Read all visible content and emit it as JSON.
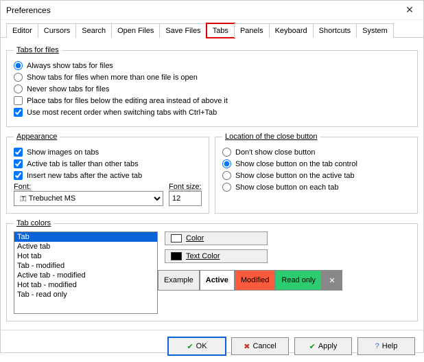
{
  "title": "Preferences",
  "tabs": [
    "Editor",
    "Cursors",
    "Search",
    "Open Files",
    "Save Files",
    "Tabs",
    "Panels",
    "Keyboard",
    "Shortcuts",
    "System"
  ],
  "activeTabIndex": 5,
  "group1": {
    "legend": "Tabs for files",
    "r1": "Always show tabs for files",
    "r2": "Show tabs for files when more than one file is open",
    "r3": "Never show tabs for files",
    "c1": "Place tabs for files below the editing area instead of above it",
    "c2": "Use most recent order when switching tabs with Ctrl+Tab"
  },
  "appearance": {
    "legend": "Appearance",
    "c1": "Show images on tabs",
    "c2": "Active tab is taller than other tabs",
    "c3": "Insert new tabs after the active tab",
    "fontLabel": "Font:",
    "fontValue": "Trebuchet MS",
    "sizeLabel": "Font size:",
    "sizeValue": "12"
  },
  "closebtn": {
    "legend": "Location of the close button",
    "r1": "Don't show close button",
    "r2": "Show close button on the tab control",
    "r3": "Show close button on the active tab",
    "r4": "Show close button on each tab"
  },
  "colors": {
    "legend": "Tab colors",
    "items": [
      "Tab",
      "Active tab",
      "Hot tab",
      "Tab - modified",
      "Active tab - modified",
      "Hot tab - modified",
      "Tab - read only"
    ],
    "btn1": "Color",
    "btn2": "Text Color",
    "ex1": "Example",
    "ex2": "Active",
    "ex3": "Modified",
    "ex4": "Read only",
    "sw1": "#ffffff",
    "sw2": "#000000"
  },
  "buttons": {
    "ok": "OK",
    "cancel": "Cancel",
    "apply": "Apply",
    "help": "Help"
  }
}
